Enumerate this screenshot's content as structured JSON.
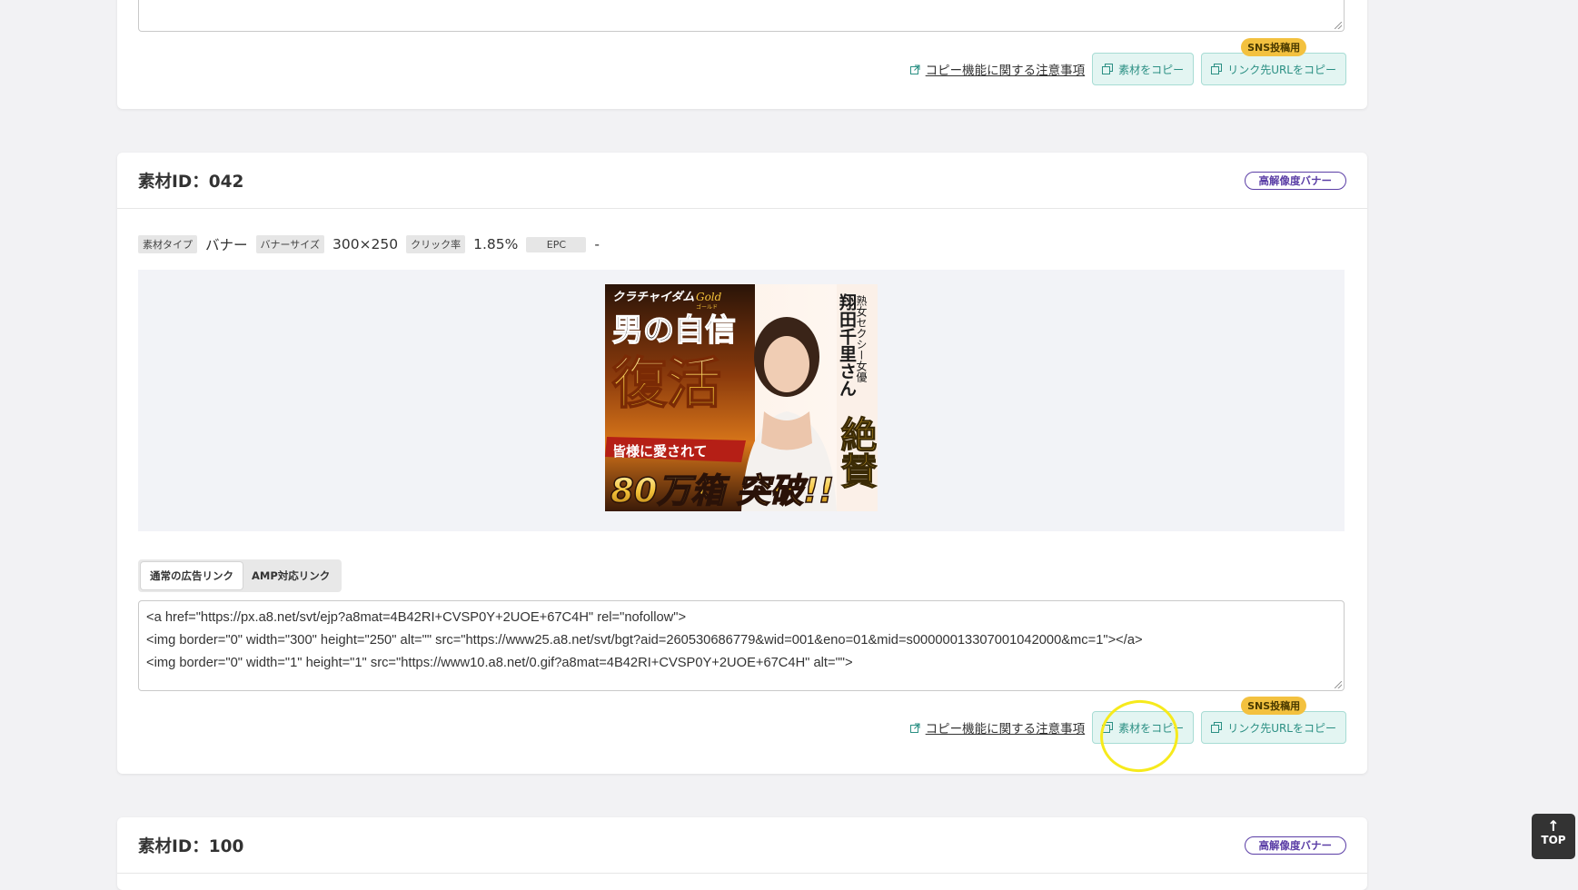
{
  "cards": {
    "top": {
      "notice_link": "コピー機能に関する注意事項",
      "copy_material": "素材をコピー",
      "copy_url": "リンク先URLをコピー",
      "sns_badge": "SNS投稿用"
    },
    "main": {
      "title": "素材ID：042",
      "badge": "高解像度バナー",
      "meta": {
        "type_label": "素材タイプ",
        "type_value": "バナー",
        "size_label": "バナーサイズ",
        "size_value": "300×250",
        "ctr_label": "クリック率",
        "ctr_value": "1.85%",
        "epc_label": "EPC",
        "epc_value": "-"
      },
      "banner": {
        "brand": "クラチャイダム",
        "brand_sub": "Gold",
        "brand_sub2": "ゴールド",
        "headline1": "男の自信",
        "headline2": "復活",
        "ribbon": "皆様に愛されて",
        "big": "80万箱 突破!!",
        "side_small": "熟女セクシー女優",
        "side_name": "翔田千里さん",
        "side_big": "絶賛"
      },
      "tabs": [
        "通常の広告リンク",
        "AMP対応リンク"
      ],
      "code_lines": [
        "<a href=\"https://px.a8.net/svt/ejp?a8mat=4B42RI+CVSP0Y+2UOE+67C4H\" rel=\"nofollow\">",
        "<img border=\"0\" width=\"300\" height=\"250\" alt=\"\" src=\"https://www25.a8.net/svt/bgt?aid=260530686779&wid=001&eno=01&mid=s00000013307001042000&mc=1\"></a>",
        "<img border=\"0\" width=\"1\" height=\"1\" src=\"https://www10.a8.net/0.gif?a8mat=4B42RI+CVSP0Y+2UOE+67C4H\" alt=\"\">"
      ],
      "notice_link": "コピー機能に関する注意事項",
      "copy_material": "素材をコピー",
      "copy_url": "リンク先URLをコピー",
      "sns_badge": "SNS投稿用"
    },
    "bottom": {
      "title": "素材ID：100",
      "badge": "高解像度バナー"
    }
  },
  "top_button": {
    "arrow": "↑",
    "label": "TOP"
  },
  "colors": {
    "accent_teal": "#2a8f83",
    "badge_purple": "#5b3ea6",
    "sns_yellow": "#f3c13f",
    "annotation": "#f6ea1c"
  }
}
